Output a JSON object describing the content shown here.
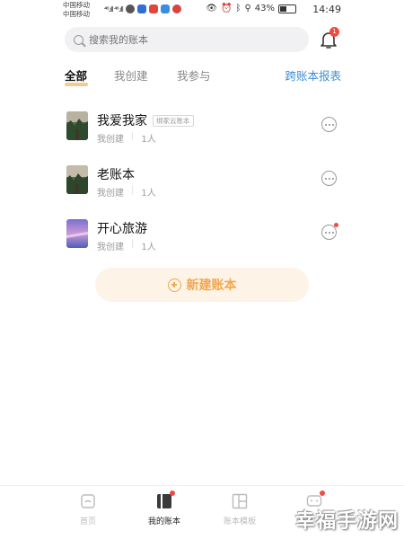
{
  "statusbar": {
    "carrier_line1": "中国移动",
    "carrier_line2": "中国移动",
    "signal_text": "⁴⁶.ıll ⁴⁶.ıll",
    "battery_percent_label": "43%",
    "battery_level": 0.43,
    "time": "14:49"
  },
  "search": {
    "placeholder": "搜索我的账本"
  },
  "notification": {
    "badge_count": "1"
  },
  "tabs": [
    {
      "label": "全部",
      "active": true
    },
    {
      "label": "我创建",
      "active": false
    },
    {
      "label": "我参与",
      "active": false
    }
  ],
  "report_link": "跨账本报表",
  "ledgers": [
    {
      "name": "我爱我家",
      "tag": "绑家云账本",
      "owner": "我创建",
      "members": "1人",
      "has_badge": false
    },
    {
      "name": "老账本",
      "tag": "",
      "owner": "我创建",
      "members": "1人",
      "has_badge": false
    },
    {
      "name": "开心旅游",
      "tag": "",
      "owner": "我创建",
      "members": "1人",
      "has_badge": true
    }
  ],
  "create_button": "新建账本",
  "bottom_nav": [
    {
      "label": "首页",
      "icon": "home-icon",
      "active": false
    },
    {
      "label": "我的账本",
      "icon": "ledger-icon",
      "active": true
    },
    {
      "label": "账本模板",
      "icon": "template-icon",
      "active": false
    },
    {
      "label": "",
      "icon": "message-icon",
      "active": false
    }
  ],
  "watermark": "幸福手游网",
  "colors": {
    "accent": "#f2a84e",
    "link": "#3f8fd8",
    "badge": "#f04b3f"
  }
}
